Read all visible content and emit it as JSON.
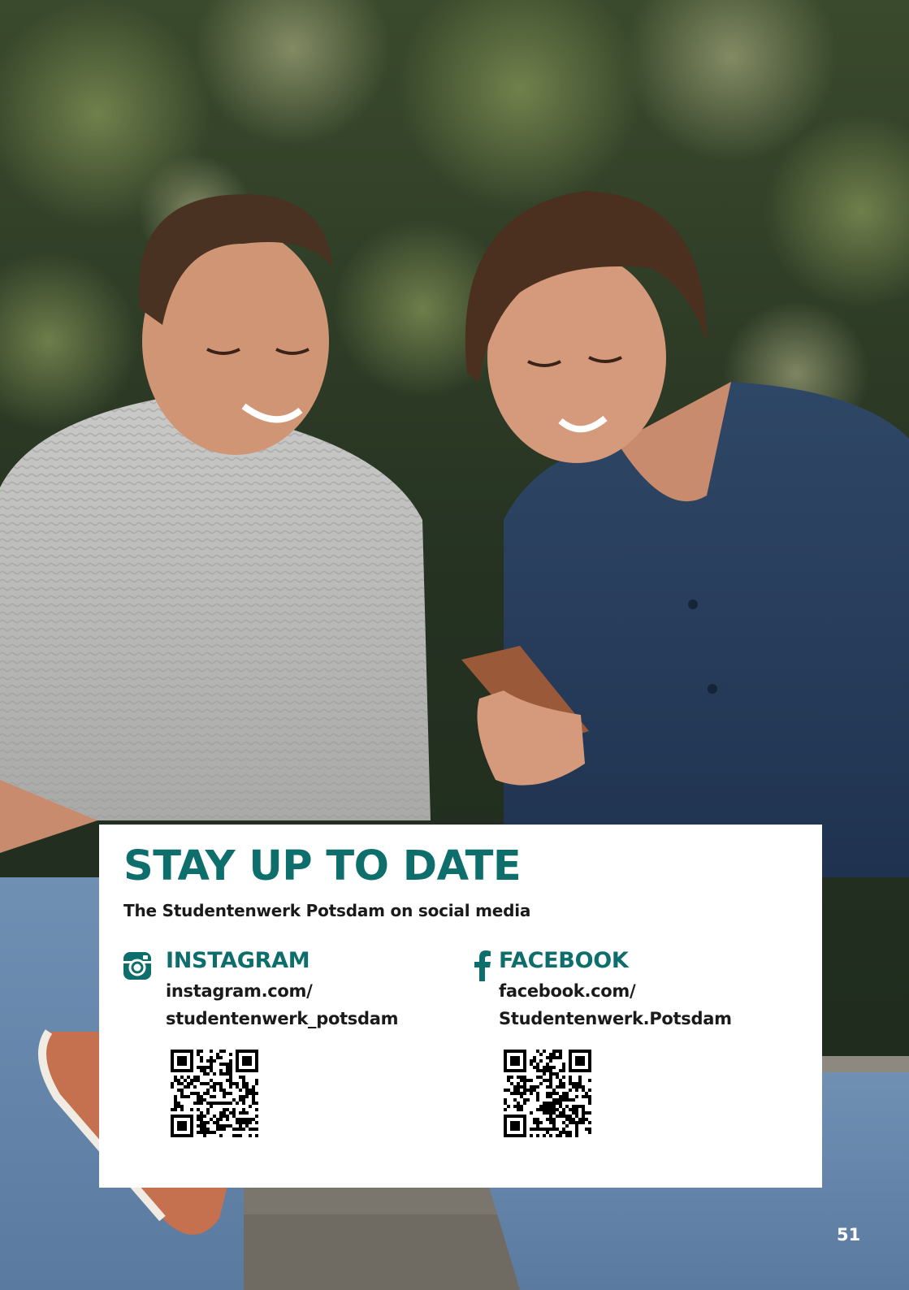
{
  "card": {
    "title": "STAY UP TO DATE",
    "subtitle": "The Studentenwerk Potsdam on social media"
  },
  "instagram": {
    "name": "INSTAGRAM",
    "url_line_1": "instagram.com/",
    "url_line_2": "studentenwerk_potsdam",
    "icon": "instagram-icon"
  },
  "facebook": {
    "name": "FACEBOOK",
    "url_line_1": "facebook.com/",
    "url_line_2": "Studentenwerk.Potsdam",
    "icon": "facebook-icon"
  },
  "page_number": "51",
  "colors": {
    "accent": "#0e6e6c",
    "text": "#1a1a1a",
    "background_foliage": "#2e3b26"
  }
}
